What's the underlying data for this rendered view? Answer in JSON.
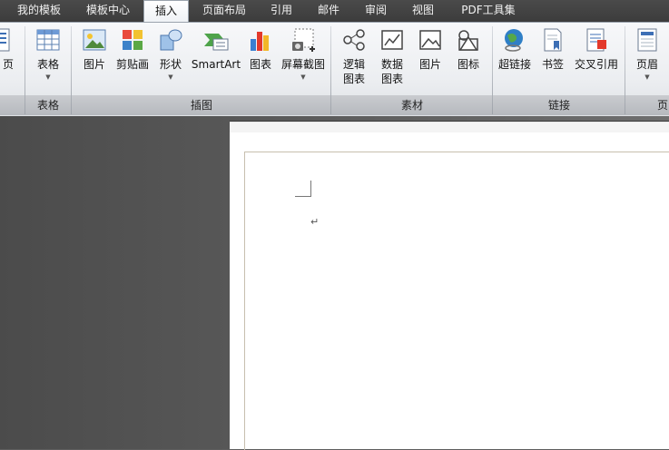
{
  "tabs": [
    {
      "label": "我的模板",
      "active": false
    },
    {
      "label": "模板中心",
      "active": false
    },
    {
      "label": "插入",
      "active": true
    },
    {
      "label": "页面布局",
      "active": false
    },
    {
      "label": "引用",
      "active": false
    },
    {
      "label": "邮件",
      "active": false
    },
    {
      "label": "审阅",
      "active": false
    },
    {
      "label": "视图",
      "active": false
    },
    {
      "label": "PDF工具集",
      "active": false
    }
  ],
  "ribbon": {
    "page_btn": {
      "label": "页"
    },
    "table_group": {
      "label": "表格",
      "buttons": [
        {
          "label": "表格",
          "icon": "table-icon"
        }
      ]
    },
    "illustrations_group": {
      "label": "插图",
      "buttons": [
        {
          "label": "图片",
          "icon": "picture-icon"
        },
        {
          "label": "剪贴画",
          "icon": "clipart-icon"
        },
        {
          "label": "形状",
          "icon": "shapes-icon"
        },
        {
          "label": "SmartArt",
          "icon": "smartart-icon"
        },
        {
          "label": "图表",
          "icon": "chart-icon"
        },
        {
          "label": "屏幕截图",
          "icon": "screenshot-icon"
        }
      ]
    },
    "materials_group": {
      "label": "素材",
      "buttons": [
        {
          "label_line1": "逻辑",
          "label_line2": "图表",
          "icon": "logic-chart-icon"
        },
        {
          "label_line1": "数据",
          "label_line2": "图表",
          "icon": "data-chart-icon"
        },
        {
          "label": "图片",
          "icon": "picture-material-icon"
        },
        {
          "label": "图标",
          "icon": "icon-material-icon"
        }
      ]
    },
    "links_group": {
      "label": "链接",
      "buttons": [
        {
          "label": "超链接",
          "icon": "hyperlink-icon"
        },
        {
          "label": "书签",
          "icon": "bookmark-icon"
        },
        {
          "label": "交叉引用",
          "icon": "cross-reference-icon"
        }
      ]
    },
    "header_group": {
      "label": "页",
      "buttons": [
        {
          "label": "页眉",
          "icon": "header-icon"
        }
      ]
    }
  },
  "document": {
    "paragraph_mark": "↵"
  },
  "colors": {
    "tab_bar": "#3c3c3c",
    "ribbon": "#eceef1",
    "doc_background": "#5d5d5d",
    "page": "#ffffff",
    "margin_line": "#c7bfae"
  }
}
